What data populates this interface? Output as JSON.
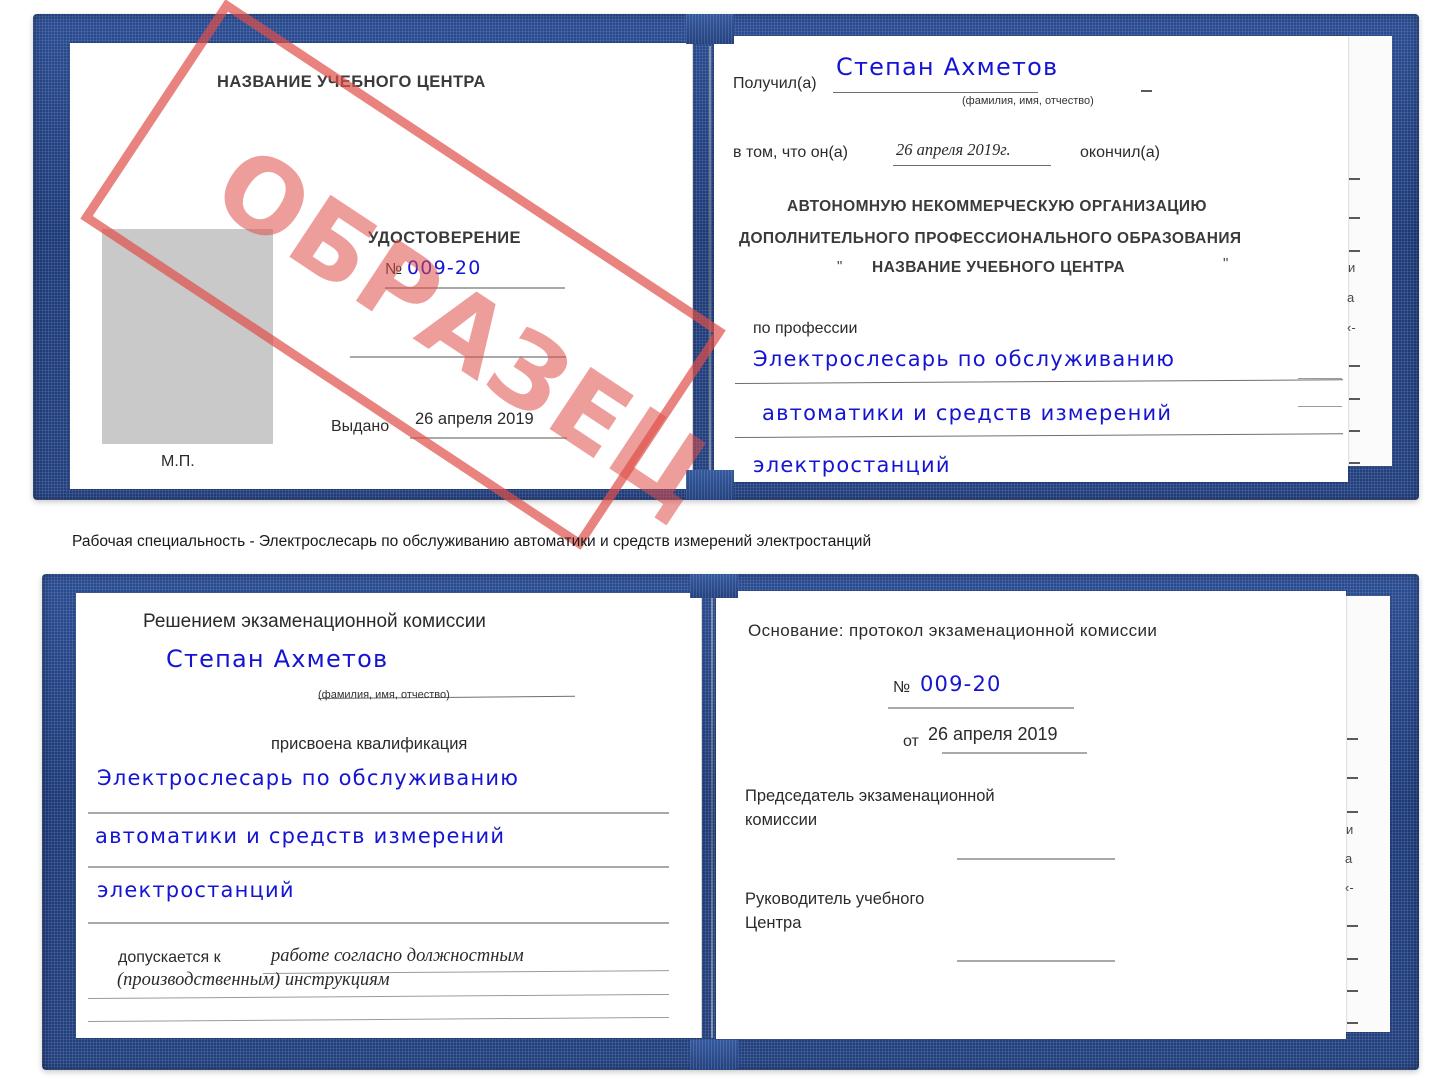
{
  "document": {
    "type": "Russian vocational training certificate (удостоверение) — sample scan",
    "watermark": "ОБРАЗЕЦ"
  },
  "certificate_top": {
    "left_page": {
      "org_header": "НАЗВАНИЕ УЧЕБНОГО ЦЕНТРА",
      "doc_title": "УДОСТОВЕРЕНИЕ",
      "number_label": "№",
      "number_value": "009-20",
      "issued_label": "Выдано",
      "issued_value": "26 апреля 2019",
      "seal_label": "М.П.",
      "photo_placeholder": "photo-area"
    },
    "right_page": {
      "received_label": "Получил(а)",
      "received_value": "Степан Ахметов",
      "fio_hint": "(фамилия, имя, отчество)",
      "in_that_label": "в том, что он(а)",
      "completion_date": "26 апреля 2019г.",
      "completed_label": "окончил(а)",
      "org_line1": "АВТОНОМНУЮ НЕКОММЕРЧЕСКУЮ ОРГАНИЗАЦИЮ",
      "org_line2": "ДОПОЛНИТЕЛЬНОГО ПРОФЕССИОНАЛЬНОГО ОБРАЗОВАНИЯ",
      "org_quote_open": "\"",
      "org_line3": "НАЗВАНИЕ УЧЕБНОГО ЦЕНТРА",
      "org_quote_close": "\"",
      "profession_label": "по профессии",
      "profession_line1": "Электрослесарь по обслуживанию",
      "profession_line2": "автоматики и средств измерений",
      "profession_line3": "электростанций"
    },
    "edge_fragments": [
      "–",
      "–",
      "–",
      "и",
      "а",
      "‹-",
      "–",
      "–",
      "–",
      "–"
    ]
  },
  "caption": {
    "text": "Рабочая специальность - Электрослесарь по обслуживанию автоматики и средств измерений электростанций"
  },
  "certificate_bottom": {
    "left_page": {
      "heading": "Решением экзаменационной комиссии",
      "name_value": "Степан Ахметов",
      "fio_hint": "(фамилия, имя, отчество)",
      "qualification_label": "присвоена квалификация",
      "qualification_line1": "Электрослесарь по обслуживанию",
      "qualification_line2": "автоматики и средств измерений",
      "qualification_line3": "электростанций",
      "admitted_label": "допускается к",
      "admitted_value_line1": "работе согласно должностным",
      "admitted_value_line2": "(производственным) инструкциям"
    },
    "right_page": {
      "basis_label": "Основание: протокол экзаменационной комиссии",
      "number_label": "№",
      "number_value": "009-20",
      "date_label": "от",
      "date_value": "26 апреля 2019",
      "chairman_line1": "Председатель экзаменационной",
      "chairman_line2": "комиссии",
      "head_line1": "Руководитель учебного",
      "head_line2": "Центра"
    },
    "edge_fragments": [
      "–",
      "–",
      "–",
      "и",
      "а",
      "‹-",
      "–",
      "–",
      "–",
      "–"
    ]
  },
  "colors": {
    "cover_blue": "#23407f",
    "stamp_red": "#df4e48",
    "handwriting_blue": "#1414d2",
    "photo_gray": "#c9c9c9",
    "paper_white": "#ffffff"
  }
}
